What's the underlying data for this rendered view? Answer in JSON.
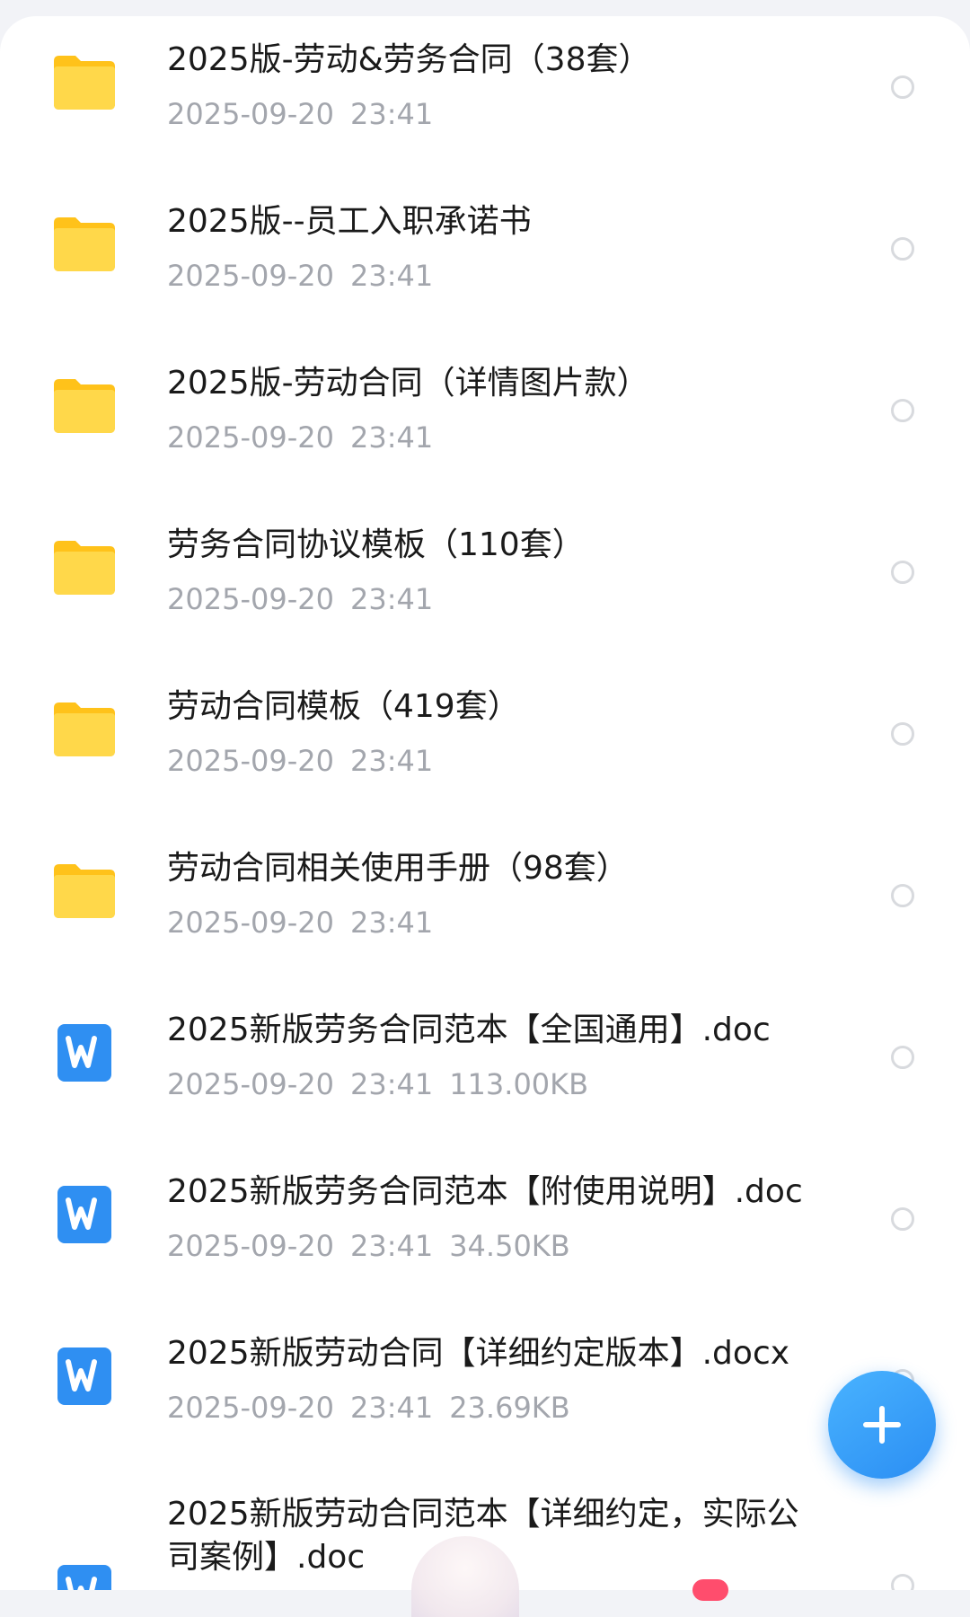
{
  "files": [
    {
      "type": "folder",
      "name": "2025版-劳动&劳务合同（38套）",
      "date": "2025-09-20",
      "time": "23:41",
      "size": ""
    },
    {
      "type": "folder",
      "name": "2025版--员工入职承诺书",
      "date": "2025-09-20",
      "time": "23:41",
      "size": ""
    },
    {
      "type": "folder",
      "name": "2025版-劳动合同（详情图片款）",
      "date": "2025-09-20",
      "time": "23:41",
      "size": ""
    },
    {
      "type": "folder",
      "name": "劳务合同协议模板（110套）",
      "date": "2025-09-20",
      "time": "23:41",
      "size": ""
    },
    {
      "type": "folder",
      "name": "劳动合同模板（419套）",
      "date": "2025-09-20",
      "time": "23:41",
      "size": ""
    },
    {
      "type": "folder",
      "name": "劳动合同相关使用手册（98套）",
      "date": "2025-09-20",
      "time": "23:41",
      "size": ""
    },
    {
      "type": "word",
      "name": "2025新版劳务合同范本【全国通用】.doc",
      "date": "2025-09-20",
      "time": "23:41",
      "size": "113.00KB"
    },
    {
      "type": "word",
      "name": "2025新版劳务合同范本【附使用说明】.doc",
      "date": "2025-09-20",
      "time": "23:41",
      "size": "34.50KB"
    },
    {
      "type": "word",
      "name": "2025新版劳动合同【详细约定版本】.docx",
      "date": "2025-09-20",
      "time": "23:41",
      "size": "23.69KB"
    },
    {
      "type": "word",
      "name": "2025新版劳动合同范本【详细约定，实际公司案例】.doc",
      "date": "",
      "time": "",
      "size": ""
    }
  ],
  "icons": {
    "folder": "folder-icon",
    "word": "word-document-icon",
    "fab": "plus-icon"
  },
  "colors": {
    "folder": "#ffcf2e",
    "word": "#2b8ef3",
    "fab": "#36a0fa",
    "meta_text": "#a3a6ad",
    "title_text": "#1a1a1a"
  }
}
